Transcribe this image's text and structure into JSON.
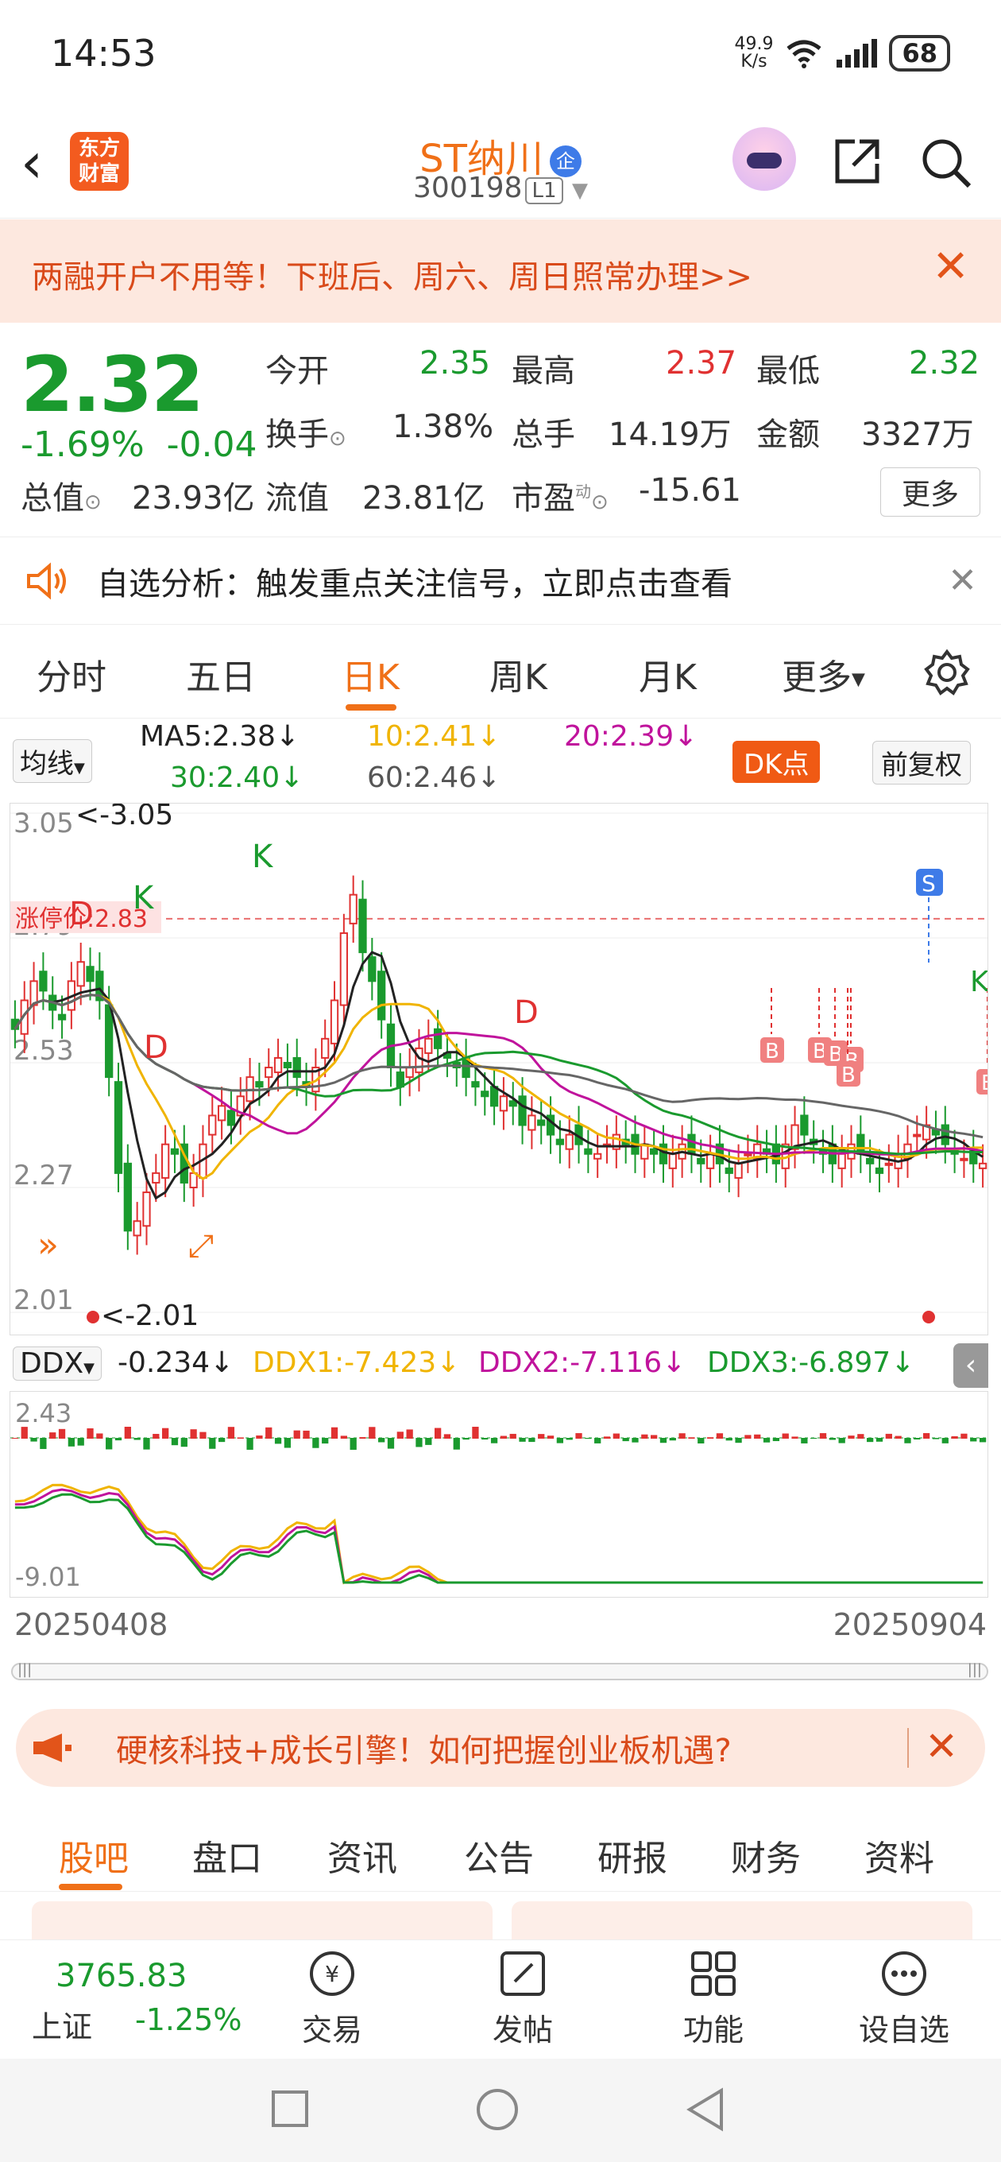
{
  "status_bar": {
    "time": "14:53",
    "net_speed_top": "49.9",
    "net_speed_bottom": "K/s",
    "battery": "68"
  },
  "header": {
    "logo_text": "东方\n财富",
    "stock_name": "ST纳川",
    "qi_badge": "企",
    "stock_code": "300198",
    "level": "L1"
  },
  "promo": {
    "text": "两融开户不用等！下班后、周六、周日照常办理>>",
    "close": "✕"
  },
  "quote": {
    "price": "2.32",
    "change_pct": "-1.69%",
    "change": "-0.04",
    "open_label": "今开",
    "open": "2.35",
    "high_label": "最高",
    "high": "2.37",
    "low_label": "最低",
    "low": "2.32",
    "turnover_label": "换手",
    "turnover": "1.38%",
    "volume_label": "总手",
    "volume": "14.19万",
    "amount_label": "金额",
    "amount": "3327万",
    "mktcap_label": "总值",
    "mktcap": "23.93亿",
    "float_label": "流值",
    "float": "23.81亿",
    "pe_label": "市盈",
    "pe_sup": "动",
    "pe": "-15.61",
    "more": "更多"
  },
  "notice": {
    "text": "自选分析：触发重点关注信号，立即点击查看",
    "close": "✕"
  },
  "period_tabs": [
    "分时",
    "五日",
    "日K",
    "周K",
    "月K",
    "更多"
  ],
  "active_tab": "日K",
  "ma": {
    "selector": "均线",
    "ma5": "MA5:2.38",
    "ma10": "10:2.41",
    "ma20": "20:2.39",
    "ma30": "30:2.40",
    "ma60": "60:2.46",
    "dk_button": "DK点",
    "adjust": "前复权",
    "arrow": "↓"
  },
  "chart_data": {
    "type": "candlestick",
    "y_ticks": [
      "3.05",
      "2.79",
      "2.53",
      "2.27",
      "2.01"
    ],
    "ylim": [
      2.01,
      3.05
    ],
    "max_label": "<-3.05",
    "min_label": "<-2.01",
    "limit_up_label": "涨停价:2.83",
    "limit_up": 2.83,
    "x_start": "20250408",
    "x_end": "20250904",
    "signal_labels": [
      "D",
      "K",
      "D",
      "K",
      "D",
      "S",
      "B",
      "B",
      "B",
      "B",
      "B",
      "B",
      "K"
    ],
    "colors": {
      "up": "#e03131",
      "down": "#1a9a2e",
      "ma5": "#222222",
      "ma10": "#f0b400",
      "ma20": "#c0139c",
      "ma30": "#1a9a2e",
      "ma60": "#666666",
      "limit": "#e03131"
    }
  },
  "ddx": {
    "selector": "DDX",
    "ddx": "-0.234",
    "ddx1": "DDX1:-7.423",
    "ddx2": "DDX2:-7.116",
    "ddx3": "DDX3:-6.897",
    "y_top": "2.43",
    "y_bottom": "-9.01"
  },
  "dates": {
    "start": "20250408",
    "end": "20250904"
  },
  "ad": {
    "text": "硬核科技+成长引擎！如何把握创业板机遇?",
    "close": "✕"
  },
  "bottom_tabs": [
    "股吧",
    "盘口",
    "资讯",
    "公告",
    "研报",
    "财务",
    "资料"
  ],
  "bottom_bar": {
    "index_value": "3765.83",
    "index_name": "上证",
    "index_change": "-1.25%",
    "trade": "交易",
    "post": "发帖",
    "func": "功能",
    "watch": "设自选",
    "trade_icon": "¥"
  }
}
